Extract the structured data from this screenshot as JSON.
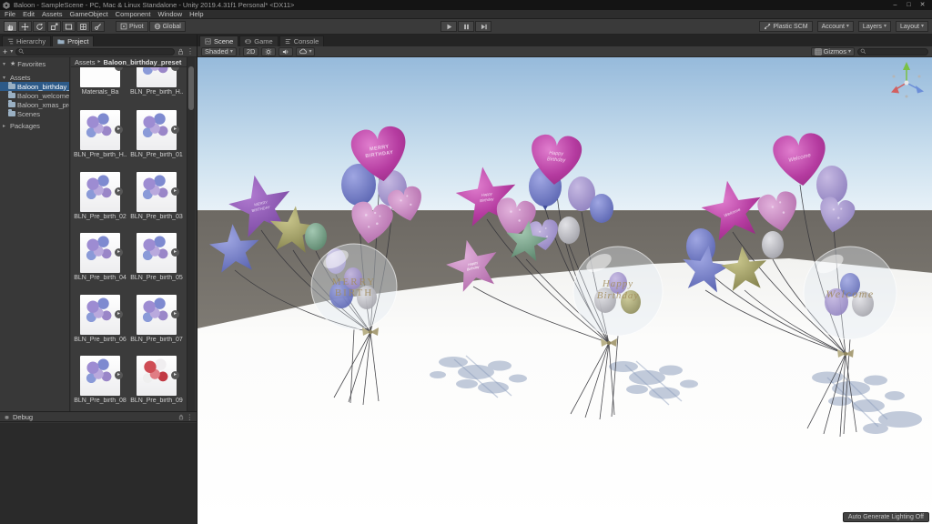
{
  "window": {
    "title": "Baloon - SampleScene - PC, Mac & Linux Standalone - Unity 2019.4.31f1 Personal* <DX11>",
    "menus": [
      "File",
      "Edit",
      "Assets",
      "GameObject",
      "Component",
      "Window",
      "Help"
    ]
  },
  "icons": {
    "minimize": "–",
    "maximize": "□",
    "close": "✕",
    "caret": "▾",
    "arrow": "▸",
    "star": "★",
    "plus": "+",
    "menu_dots": "⋮"
  },
  "toolbar": {
    "pivot": "Pivot",
    "global": "Global",
    "plastic_scm": "Plastic SCM",
    "account": "Account",
    "layers": "Layers",
    "layout": "Layout"
  },
  "left_panel": {
    "tabs": [
      {
        "label": "Hierarchy"
      },
      {
        "label": "Project"
      }
    ],
    "favorites": "Favorites",
    "assets_root": "Assets",
    "folders": [
      "Baloon_birthday_",
      "Baloon_welcome",
      "Baloon_xmas_pre",
      "Scenes"
    ],
    "packages": "Packages",
    "breadcrumb": {
      "root": "Assets",
      "current": "Baloon_birthday_preset"
    },
    "grid": [
      {
        "label": "Materials_Ba",
        "variant": "blank"
      },
      {
        "label": "BLN_Pre_birth_H...",
        "variant": "purple"
      },
      {
        "label": "BLN_Pre_birth_H...",
        "variant": "purple"
      },
      {
        "label": "BLN_Pre_birth_01",
        "variant": "purple"
      },
      {
        "label": "BLN_Pre_birth_02",
        "variant": "purple"
      },
      {
        "label": "BLN_Pre_birth_03",
        "variant": "purple"
      },
      {
        "label": "BLN_Pre_birth_04",
        "variant": "purple"
      },
      {
        "label": "BLN_Pre_birth_05",
        "variant": "purple"
      },
      {
        "label": "BLN_Pre_birth_06",
        "variant": "purple"
      },
      {
        "label": "BLN_Pre_birth_07",
        "variant": "purple"
      },
      {
        "label": "BLN_Pre_birth_08",
        "variant": "purple"
      },
      {
        "label": "BLN_Pre_birth_09",
        "variant": "red"
      }
    ],
    "debug": "Debug"
  },
  "scene": {
    "tabs": [
      "Scene",
      "Game",
      "Console"
    ],
    "shading_mode": "Shaded",
    "toggle_2d": "2D",
    "gizmos": "Gizmos",
    "status_bar": "Auto Generate Lighting Off",
    "balloon_text": {
      "left_heart_1": "MERRY",
      "left_heart_2": "BIRTHDAY",
      "left_star_1": "MERRY",
      "left_star_2": "BIRTHDAY",
      "left_bubble_1": "MERRY",
      "left_bubble_2": "BIRTH",
      "mid_heart_1": "Happy",
      "mid_heart_2": "Birthday",
      "mid_star_1": "Happy",
      "mid_star_2": "Birthday",
      "mid_star_b_1": "Happy",
      "mid_star_b_2": "Birthday",
      "mid_bubble_1": "Happy",
      "mid_bubble_2": "Birthday",
      "right_heart": "Welcome",
      "right_star": "Welcome",
      "right_bubble": "Welcome"
    }
  },
  "colors": {
    "selection_blue": "#2d5a88",
    "magenta_balloon": "#b53ba0",
    "sky_top": "#96badb"
  }
}
